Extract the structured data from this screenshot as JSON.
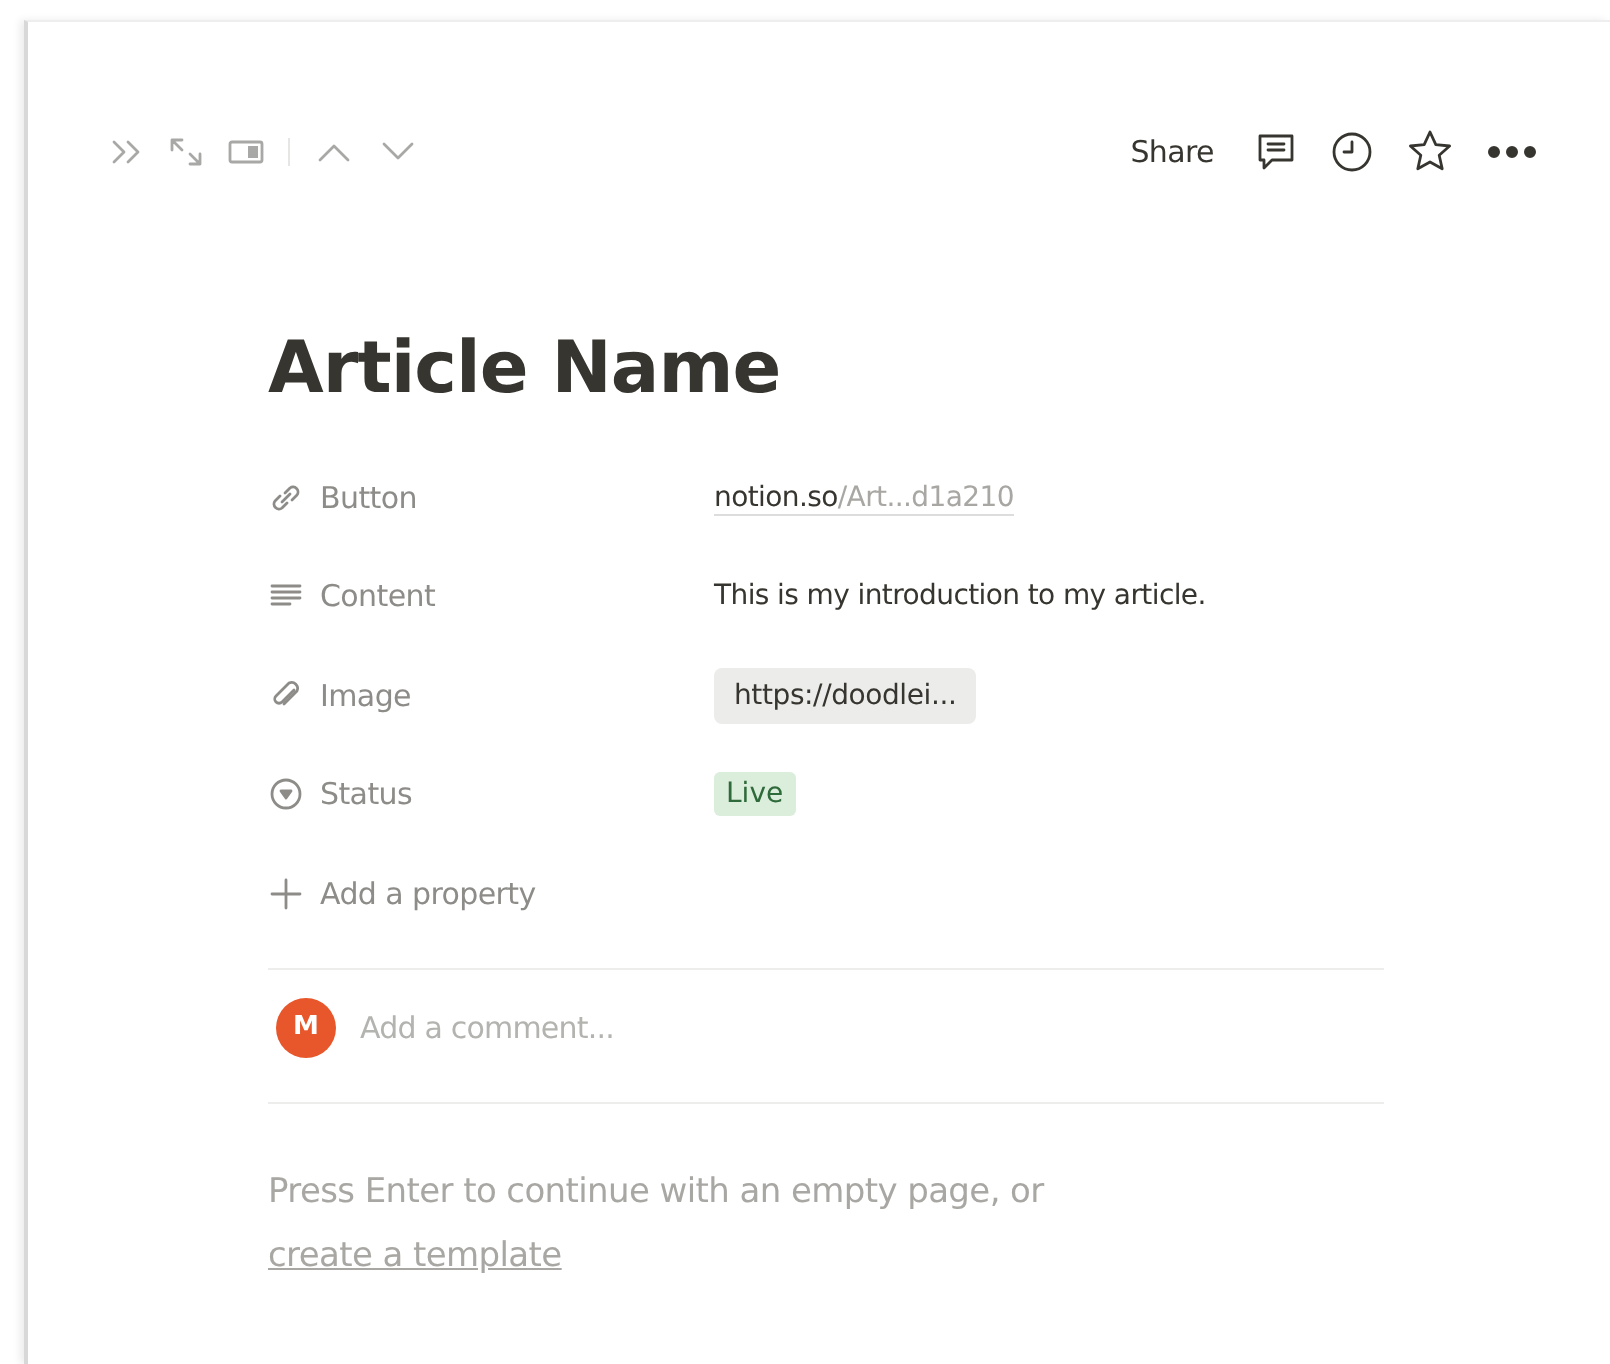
{
  "toolbar": {
    "share": "Share"
  },
  "page": {
    "title": "Article Name"
  },
  "properties": [
    {
      "kind": "url",
      "label": "Button",
      "value_host": "notion.so",
      "value_path": "/Art...d1a210"
    },
    {
      "kind": "text",
      "label": "Content",
      "value": "This is my introduction to my article."
    },
    {
      "kind": "file",
      "label": "Image",
      "value": "https://doodlei..."
    },
    {
      "kind": "status",
      "label": "Status",
      "value": "Live"
    }
  ],
  "add_property": "Add a property",
  "comment": {
    "avatar": "M",
    "placeholder": "Add a comment..."
  },
  "empty_hint": {
    "text": "Press Enter to continue with an empty page, or",
    "link": "create a template"
  }
}
